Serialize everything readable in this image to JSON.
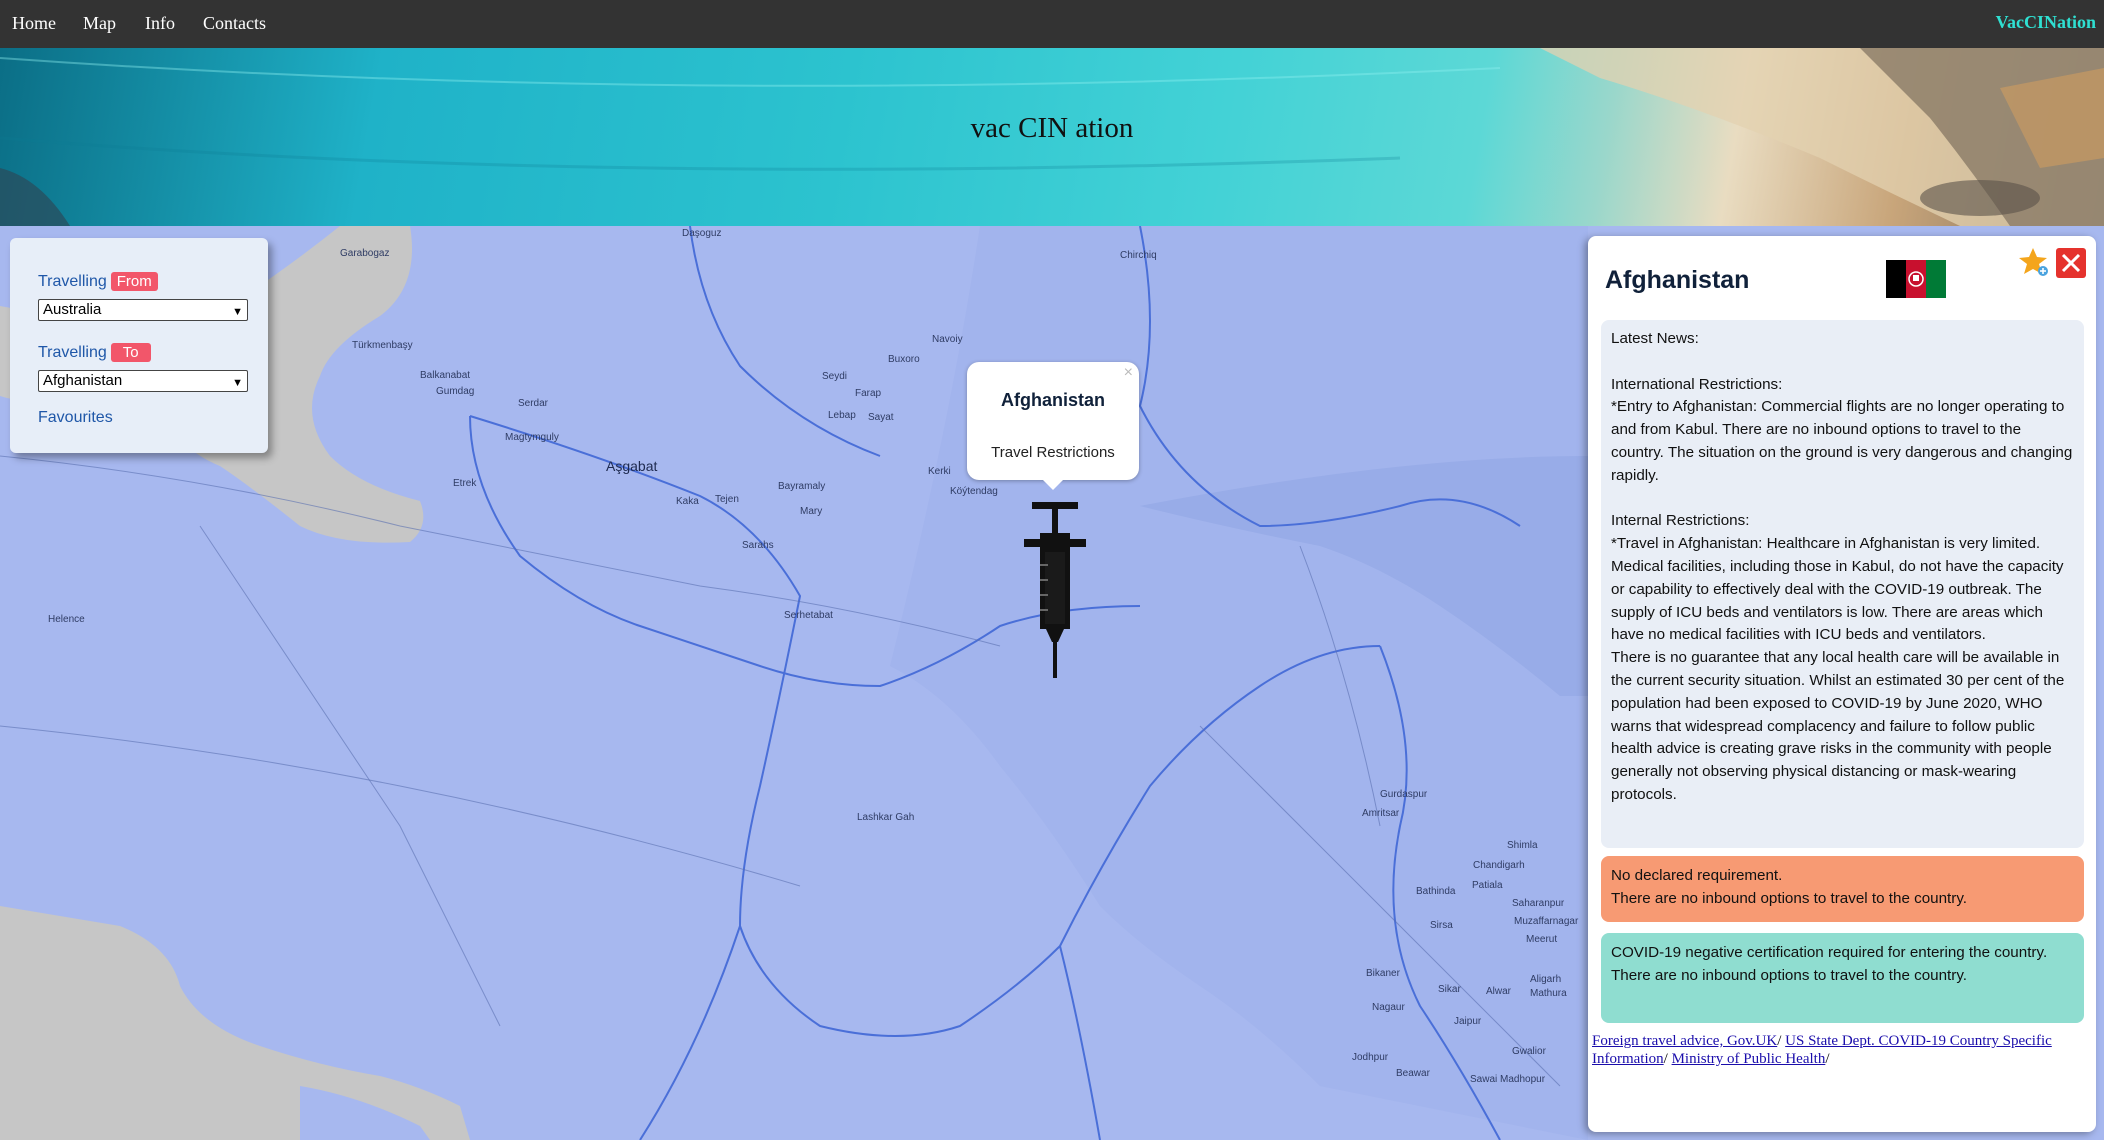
{
  "nav": {
    "links": [
      "Home",
      "Map",
      "Info",
      "Contacts"
    ],
    "brand": "VacCINation"
  },
  "hero": {
    "title": "vac CIN ation"
  },
  "left_panel": {
    "from_label": "Travelling",
    "from_badge": "From",
    "from_value": "Australia",
    "to_label": "Travelling",
    "to_badge": "To",
    "to_value": "Afghanistan",
    "favourites": "Favourites"
  },
  "popup": {
    "close": "×",
    "title": "Afghanistan",
    "subtitle": "Travel Restrictions"
  },
  "map_labels": {
    "asgabat": "Aşgabat",
    "garabogaz": "Garabogaz",
    "turkmenbasy": "Türkmenbaşy",
    "balkanabat": "Balkanabat",
    "gumdag": "Gumdag",
    "serdar": "Serdar",
    "magtymguly": "Magtymguly",
    "etrek": "Etrek",
    "kaka": "Kaka",
    "tejen": "Tejen",
    "bayramaly": "Bayramaly",
    "mary": "Mary",
    "sarahs": "Sarahs",
    "serhetabat": "Serhetabat",
    "seydi": "Seydi",
    "farap": "Farap",
    "sayat": "Sayat",
    "lebap": "Lebap",
    "buxoro": "Buxoro",
    "navoiy": "Navoiy",
    "kerki": "Kerki",
    "koytendag": "Köýtendag",
    "dasoguz": "Daşoguz",
    "chirchiq": "Chirchiq",
    "lashkar_gah": "Lashkar Gah",
    "amritsar": "Amritsar",
    "gurdaspur": "Gurdaspur",
    "chandigarh": "Chandigarh",
    "patiala": "Patiala",
    "bathinda": "Bathinda",
    "shimla": "Shimla",
    "saharanpur": "Saharanpur",
    "muzaffarnagar": "Muzaffarnagar",
    "meerut": "Meerut",
    "sirsa": "Sirsa",
    "bikaner": "Bikaner",
    "sikar": "Sikar",
    "alwar": "Alwar",
    "aligarh": "Aligarh",
    "mathura": "Mathura",
    "nagaur": "Nagaur",
    "jaipur": "Jaipur",
    "jodhpur": "Jodhpur",
    "beawar": "Beawar",
    "sawai_madhopur": "Sawai Madhopur",
    "gwalior": "Gwalior",
    "helence": "Helence"
  },
  "right_panel": {
    "country": "Afghanistan",
    "news": [
      "Latest News:",
      "",
      "International Restrictions:",
      "*Entry to Afghanistan: Commercial flights are no longer operating to and from Kabul. There are no inbound options to travel to the country. The situation on the ground is very dangerous and changing rapidly.",
      "",
      "Internal Restrictions:",
      "*Travel in Afghanistan: Healthcare in Afghanistan is very limited. Medical facilities, including those in Kabul, do not have the capacity or capability to effectively deal with the COVID-19 outbreak. The supply of ICU beds and ventilators is low. There are areas which have no medical facilities with ICU beds and ventilators.",
      "There is no guarantee that any local health care will be available in the current security situation. Whilst an estimated 30 per cent of the population had been exposed to COVID-19 by June 2020, WHO warns that widespread complacency and failure to follow public health advice is creating grave risks in the community with people generally not observing physical distancing or mask-wearing protocols."
    ],
    "orange_box": {
      "line1": "No declared requirement.",
      "line2": "There are no inbound options to travel to the country."
    },
    "teal_box": {
      "line1": "COVID-19 negative certification required for entering the country.",
      "line2": "There are no inbound options to travel to the country."
    },
    "links": [
      "Foreign travel advice, Gov.UK",
      "US State Dept. COVID-19 Country Specific Information",
      "Ministry of Public Health"
    ],
    "link_separator": "/ "
  },
  "colors": {
    "nav_bg": "#333333",
    "brand": "#2fe0d2",
    "map_land": "#a7b8ef",
    "map_sea": "#c6c6c6",
    "badge": "#f2566a",
    "orange_box": "#f79a73",
    "teal_box": "#8fddd0",
    "close_button": "#e5322d"
  },
  "icons": {
    "favourite": "star-plus-icon",
    "close": "close-icon",
    "marker": "syringe-icon",
    "flag": "afghanistan-flag"
  }
}
